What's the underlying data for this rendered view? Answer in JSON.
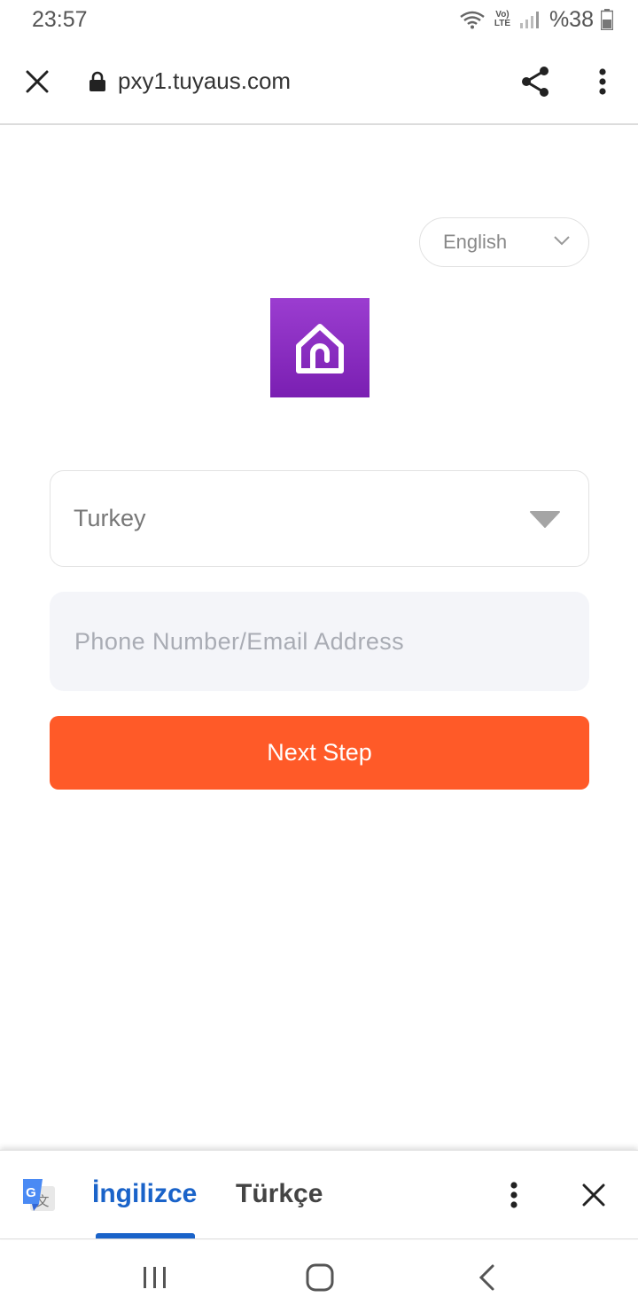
{
  "status_bar": {
    "time": "23:57",
    "network_label": "Vo) LTE",
    "battery": "%38"
  },
  "browser": {
    "url": "pxy1.tuyaus.com"
  },
  "login": {
    "language": "English",
    "country": "Turkey",
    "contact_placeholder": "Phone Number/Email Address",
    "contact_value": "",
    "next_label": "Next Step",
    "accent_color": "#ff5a28",
    "logo_color": "#8a2ec6"
  },
  "translate_bar": {
    "source_language": "İngilizce",
    "target_language": "Türkçe",
    "active_color": "#1a63c9"
  },
  "icons": {
    "close": "close-icon",
    "lock": "lock-icon",
    "share": "share-icon",
    "menu": "more-vert-icon",
    "chevron": "chevron-down-icon",
    "caret": "caret-down-icon",
    "home_logo": "smart-home-icon",
    "translate": "google-translate-icon"
  }
}
